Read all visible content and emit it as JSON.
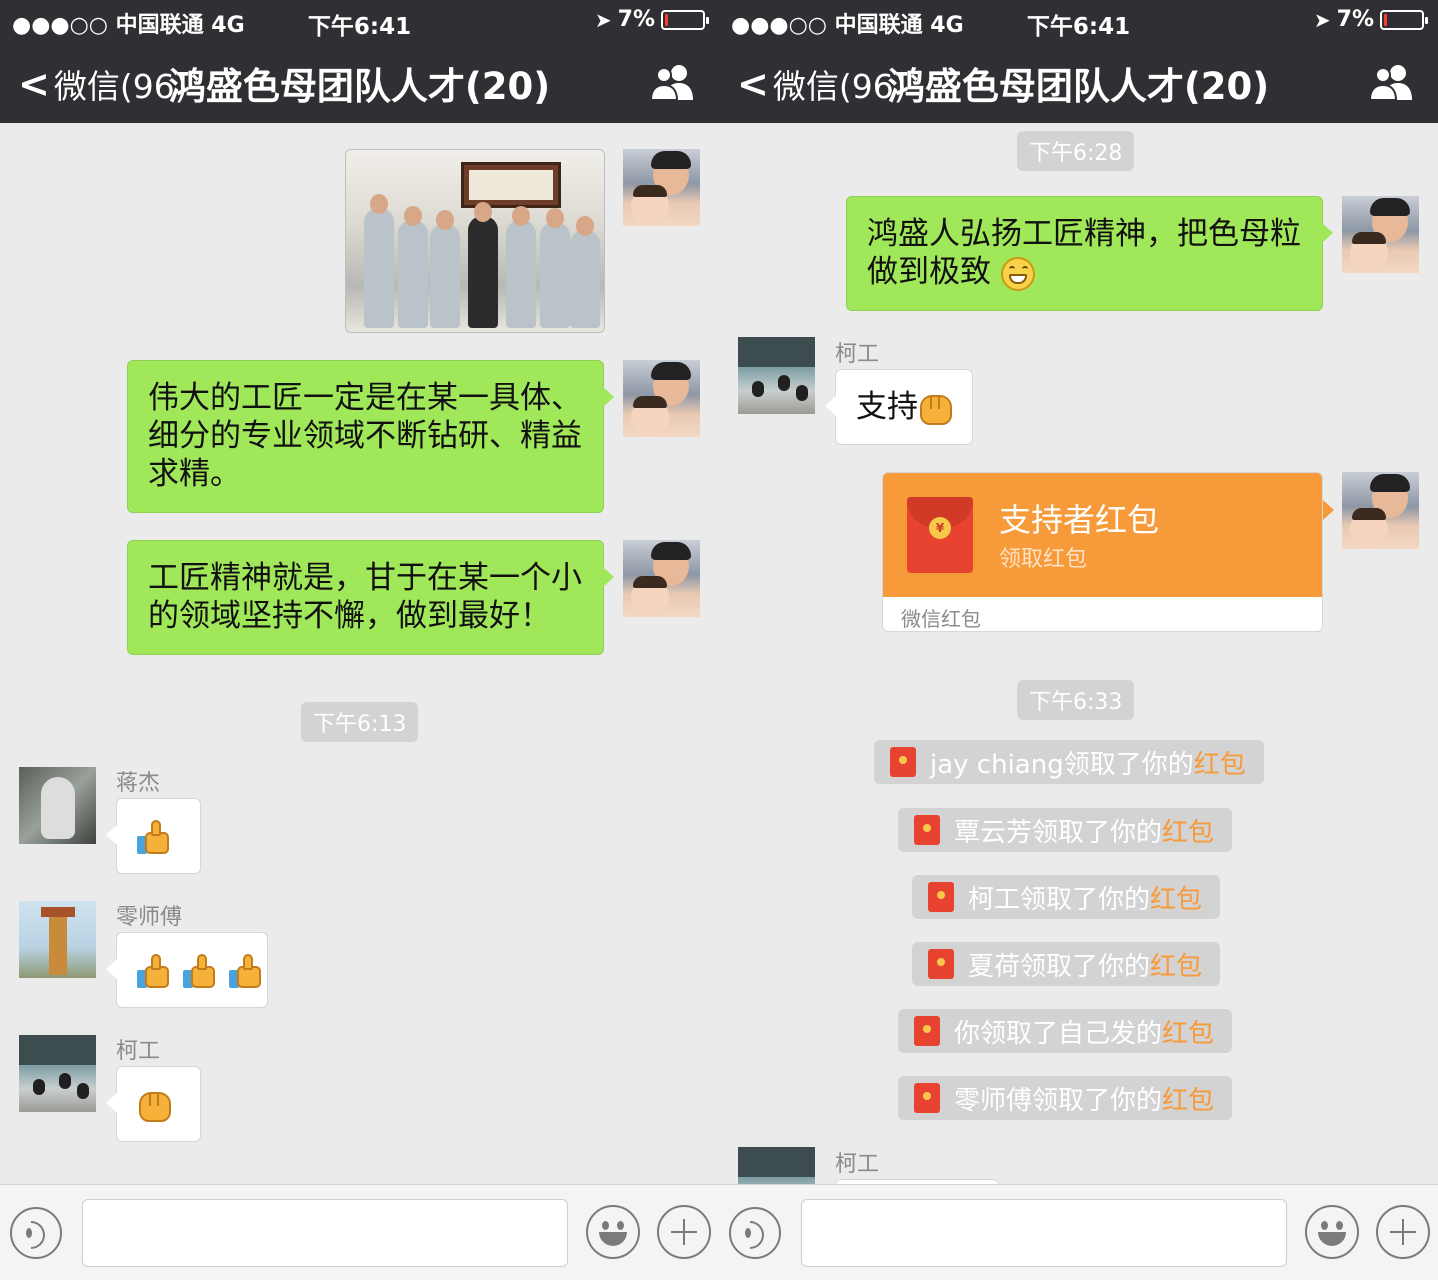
{
  "status_bar": {
    "carrier": "●●●○○ 中国联通  4G",
    "time": "下午6:41",
    "battery_text": "7%",
    "battery_level": 0.07,
    "battery_color": "#ff3b30"
  },
  "nav": {
    "back_label": "微信(96)",
    "title": "鸿盛色母团队人才(20)",
    "members_icon": "group-members-icon"
  },
  "left_chat": {
    "m1_text": "伟大的工匠一定是在某一具体、细分的专业领域不断钻研、精益求精。",
    "m2_text": "工匠精神就是，甘于在某一个小的领域坚持不懈，做到最好！",
    "time_1": "下午6:13",
    "s1_name": "蒋杰",
    "s2_name": "零师傅",
    "s3_name": "柯工"
  },
  "right_chat": {
    "time_1": "下午6:28",
    "m1_text": "鸿盛人弘扬工匠精神，把色母粒做到极致",
    "s1_name": "柯工",
    "s1_text": "支持",
    "redpacket": {
      "title": "支持者红包",
      "subtitle": "领取红包",
      "footer": "微信红包",
      "coin": "¥"
    },
    "time_2": "下午6:33",
    "notices": [
      {
        "text": "jay chiang领取了你的",
        "link": "红包"
      },
      {
        "text": "覃云芳领取了你的",
        "link": "红包"
      },
      {
        "text": "柯工领取了你的",
        "link": "红包"
      },
      {
        "text": "夏荷领取了你的",
        "link": "红包"
      },
      {
        "text": "你领取了自己发的",
        "link": "红包"
      },
      {
        "text": "零师傅领取了你的",
        "link": "红包"
      }
    ],
    "s2_name": "柯工"
  },
  "colors": {
    "navbar": "#2f3033",
    "bubble_green": "#a0e75a",
    "redpacket_orange": "#f79a3a",
    "link_orange": "#f79a3a"
  },
  "input_bar": {
    "voice_icon": "voice-icon",
    "emoji_icon": "emoji-icon",
    "plus_icon": "plus-icon"
  }
}
